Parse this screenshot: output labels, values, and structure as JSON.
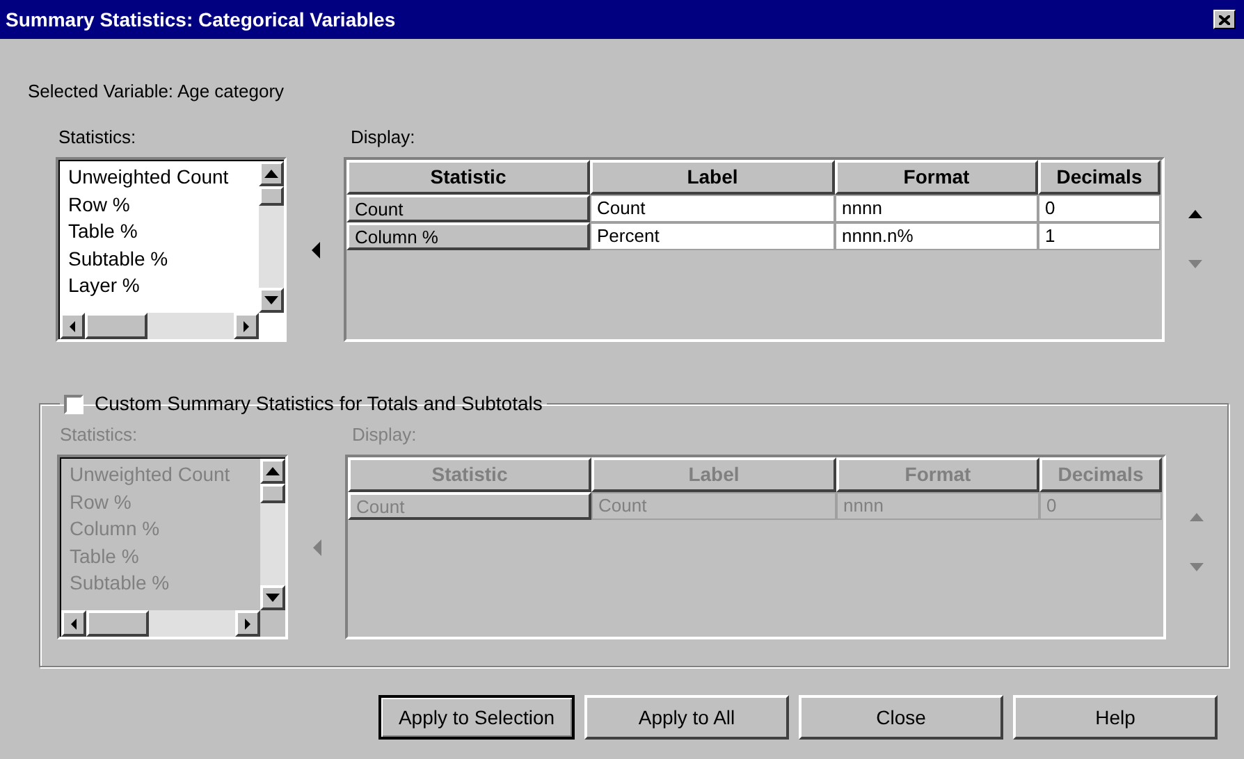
{
  "window": {
    "title": "Summary Statistics: Categorical Variables"
  },
  "selected_variable": "Selected Variable: Age category",
  "main": {
    "disabled": false,
    "statistics_label": "Statistics:",
    "statistics": [
      "Unweighted Count",
      "Row %",
      "Table %",
      "Subtable %",
      "Layer %"
    ],
    "display_label": "Display:",
    "columns": [
      "Statistic",
      "Label",
      "Format",
      "Decimals"
    ],
    "rows": [
      [
        "Count",
        "Count",
        "nnnn",
        "0"
      ],
      [
        "Column %",
        "Percent",
        "nnnn.n%",
        "1"
      ]
    ],
    "move_up_disabled": false,
    "move_down_disabled": true
  },
  "totals": {
    "checkbox": {
      "label": "Custom Summary Statistics for Totals and Subtotals",
      "checked": false
    },
    "disabled": true,
    "statistics_label": "Statistics:",
    "statistics": [
      "Unweighted Count",
      "Row %",
      "Column %",
      "Table %",
      "Subtable %"
    ],
    "display_label": "Display:",
    "columns": [
      "Statistic",
      "Label",
      "Format",
      "Decimals"
    ],
    "rows": [
      [
        "Count",
        "Count",
        "nnnn",
        "0"
      ]
    ],
    "move_up_disabled": true,
    "move_down_disabled": true
  },
  "buttons": [
    {
      "label": "Apply to Selection",
      "default": true
    },
    {
      "label": "Apply to All",
      "default": false
    },
    {
      "label": "Close",
      "default": false
    },
    {
      "label": "Help",
      "default": false
    }
  ]
}
